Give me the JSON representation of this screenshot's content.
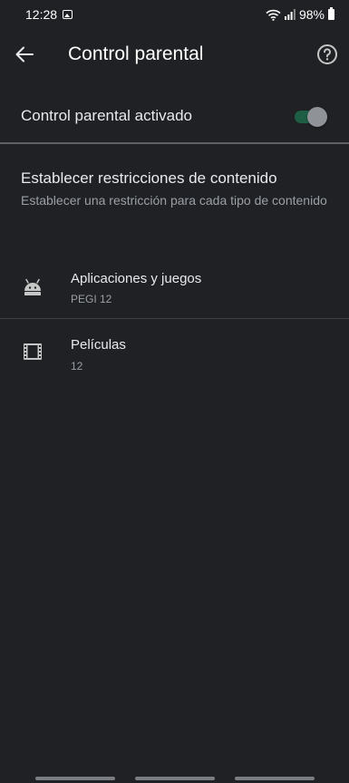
{
  "status_bar": {
    "time": "12:28",
    "battery": "98%",
    "icons": [
      "image-icon",
      "wifi-icon",
      "signal-icon",
      "battery-icon"
    ]
  },
  "app_bar": {
    "title": "Control parental",
    "icons": [
      "back-arrow-icon",
      "help-icon"
    ]
  },
  "toggle": {
    "label": "Control parental activado",
    "state": "on",
    "accent_color": "#1d5e45"
  },
  "restrictions": {
    "title": "Establecer restricciones de contenido",
    "subtitle": "Establecer una restricción para cada tipo de contenido"
  },
  "content_types": [
    {
      "icon": "android-icon",
      "title": "Aplicaciones y juegos",
      "rating": "PEGI 12"
    },
    {
      "icon": "film-icon",
      "title": "Películas",
      "rating": "12"
    }
  ],
  "colors": {
    "background": "#202124",
    "primary_text": "#e8eaed",
    "secondary_text": "#9aa0a6"
  }
}
